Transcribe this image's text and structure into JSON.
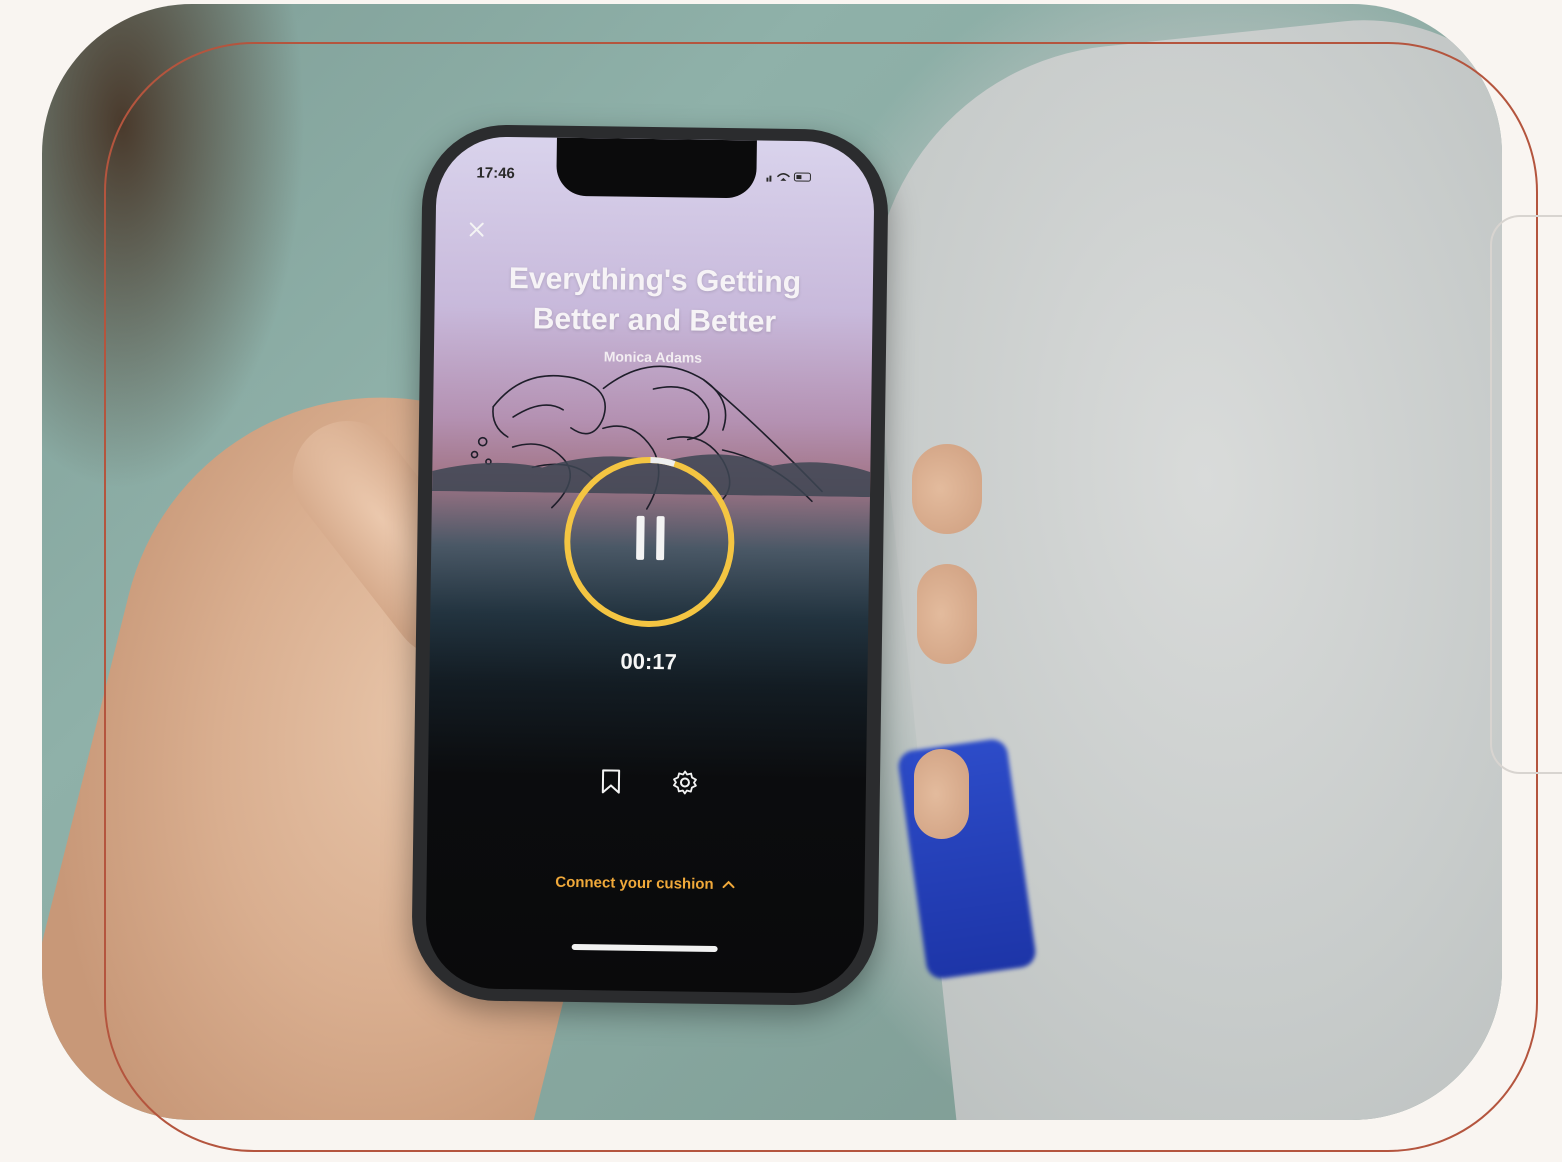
{
  "app": {
    "status_time": "17:46",
    "title_line1": "Everything's Getting",
    "title_line2": "Better and Better",
    "author": "Monica Adams",
    "elapsed": "00:17",
    "connect_label": "Connect your cushion",
    "progress": 0.05
  },
  "icons": {
    "close": "close-icon",
    "pause": "pause-icon",
    "bookmark": "bookmark-icon",
    "settings": "gear-icon",
    "chevron": "chevron-up-icon"
  },
  "colors": {
    "accent": "#f4c542",
    "frame": "#b4553e",
    "connect": "#f0a93a"
  }
}
